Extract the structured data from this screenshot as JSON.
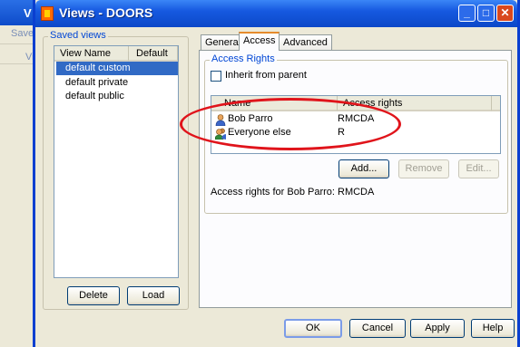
{
  "window": {
    "title": "Views - DOORS",
    "minimize_glyph": "_",
    "maximize_glyph": "□",
    "close_glyph": "✕"
  },
  "background_window": {
    "title_fragment": "V",
    "text1": "Save",
    "text2": "Vie"
  },
  "saved_views": {
    "group_label": "Saved views",
    "columns": [
      "View Name",
      "Default"
    ],
    "items": [
      "default custom",
      "default private",
      "default public"
    ],
    "selected_index": 0,
    "delete_label": "Delete",
    "load_label": "Load"
  },
  "tabs": [
    {
      "label": "General",
      "active": false
    },
    {
      "label": "Access",
      "active": true
    },
    {
      "label": "Advanced",
      "active": false
    }
  ],
  "access_rights": {
    "group_label": "Access Rights",
    "inherit_label": "Inherit from parent",
    "inherit_checked": false,
    "columns": [
      "Name",
      "Access rights"
    ],
    "rows": [
      {
        "name": "Bob Parro",
        "rights": "RMCDA",
        "icon": "user-icon"
      },
      {
        "name": "Everyone else",
        "rights": "R",
        "icon": "group-icon"
      }
    ],
    "add_label": "Add...",
    "remove_label": "Remove",
    "edit_label": "Edit...",
    "status_text": "Access rights for Bob Parro: RMCDA"
  },
  "buttons": {
    "ok": "OK",
    "cancel": "Cancel",
    "apply": "Apply",
    "help": "Help"
  },
  "colors": {
    "selection": "#316ac5",
    "annotation": "#e0141b",
    "titlebar": "#1659e0"
  }
}
